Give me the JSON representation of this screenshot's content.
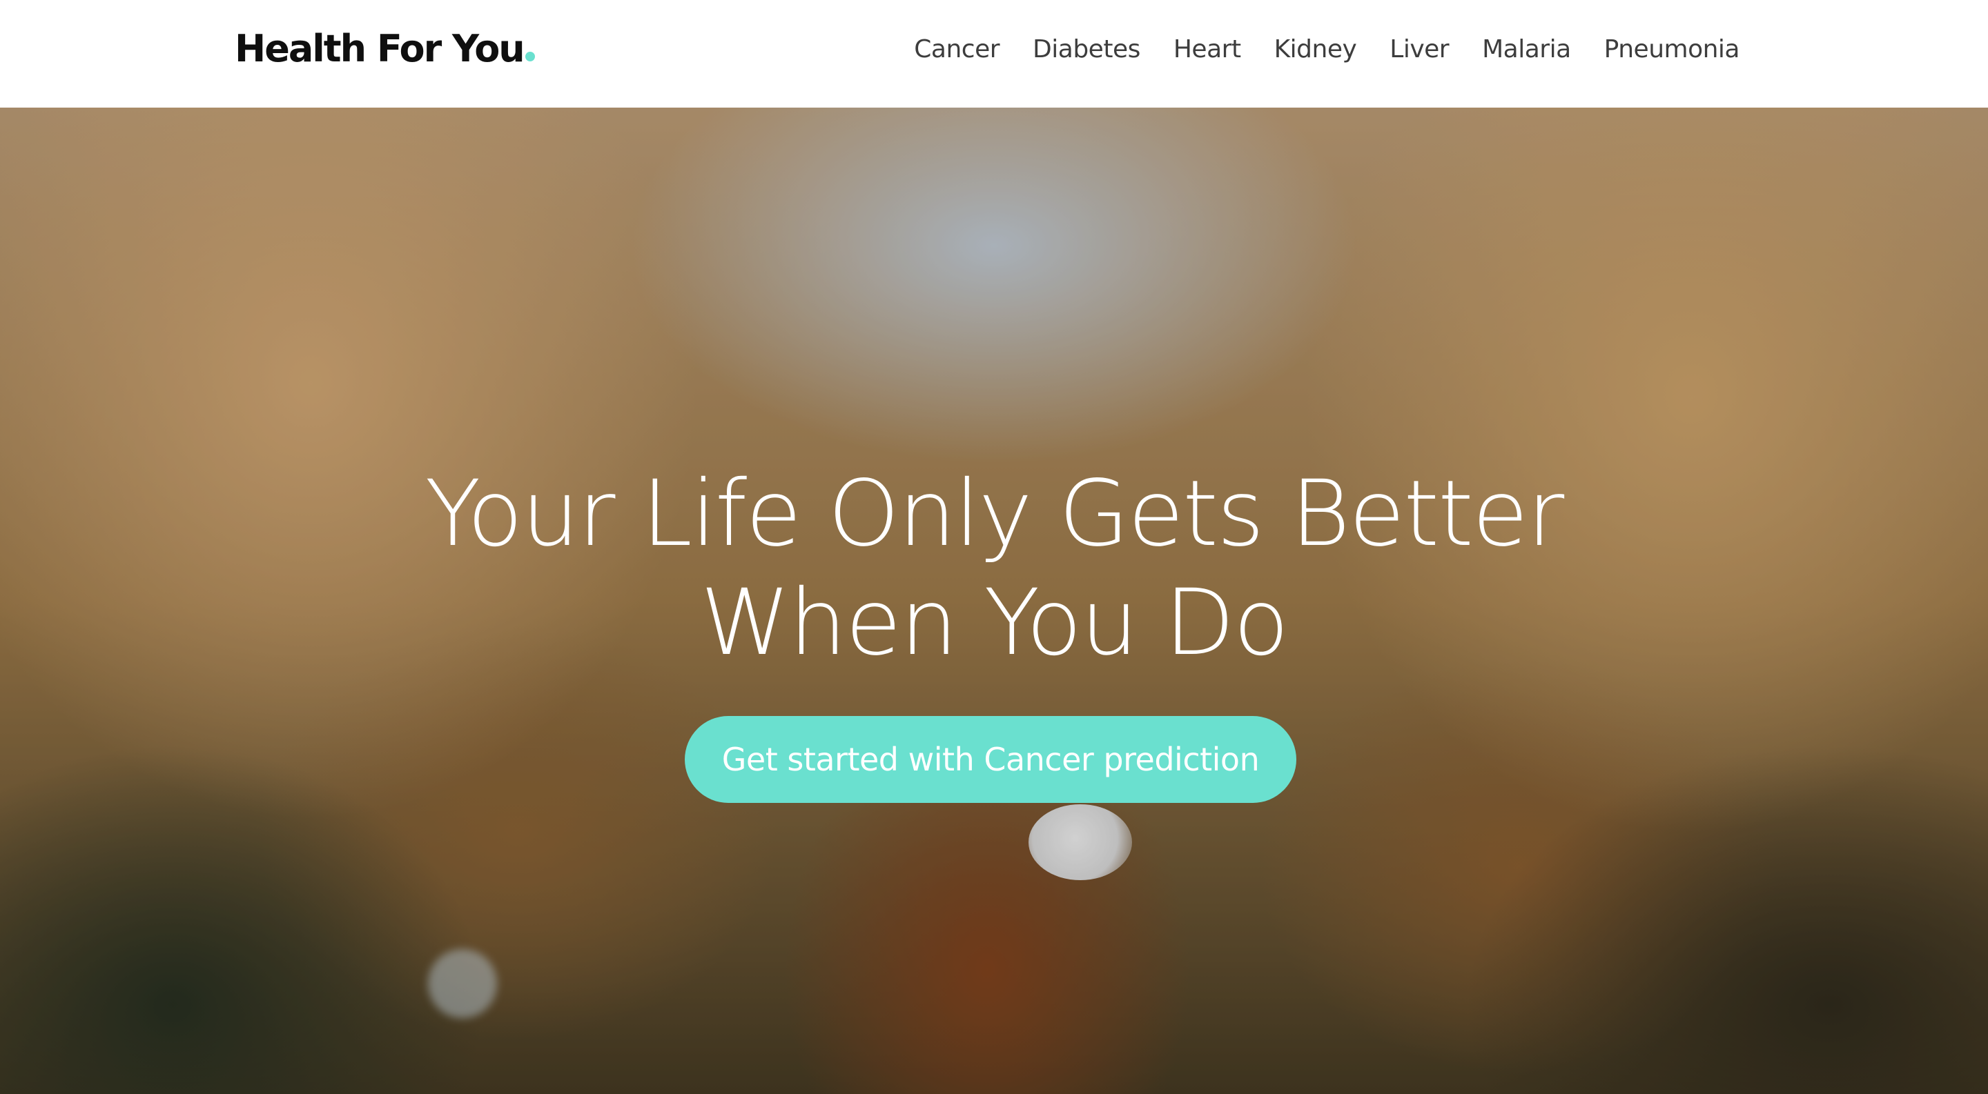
{
  "brand": {
    "name": "Health For You",
    "dot": ".",
    "accent_color": "#6ae0cf"
  },
  "nav": {
    "items": [
      {
        "label": "Cancer"
      },
      {
        "label": "Diabetes"
      },
      {
        "label": "Heart"
      },
      {
        "label": "Kidney"
      },
      {
        "label": "Liver"
      },
      {
        "label": "Malaria"
      },
      {
        "label": "Pneumonia"
      }
    ]
  },
  "hero": {
    "title_line1": "Your Life Only Gets Better",
    "title_line2": "When You Do",
    "cta_label": "Get started with Cancer prediction",
    "cta_color": "#6ae0cf"
  }
}
